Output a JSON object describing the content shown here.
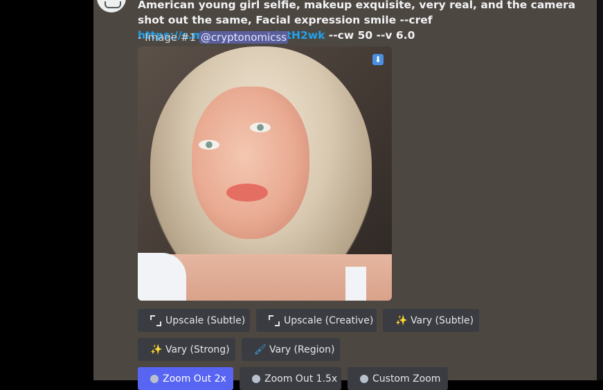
{
  "message": {
    "prompt_text": "American young girl selfie, makeup exquisite, very real, and the camera shot out the same, Facial expression smile --cref ",
    "prompt_link": "https://s.mj.run/WmARjTtH2wk",
    "prompt_suffix": " --cw 50 --v 6.0",
    "image_label": "- Image #1 ",
    "mention": "@cryptonomicss"
  },
  "image": {
    "description_icon": "download-icon",
    "download_glyph": "⬇"
  },
  "buttons": {
    "row1": [
      {
        "label": "Upscale (Subtle)",
        "icon": "expand-icon"
      },
      {
        "label": "Upscale (Creative)",
        "icon": "expand-icon"
      },
      {
        "label": "Vary (Subtle)",
        "icon": "magic-wand-icon"
      }
    ],
    "row2": [
      {
        "label": "Vary (Strong)",
        "icon": "magic-wand-icon"
      },
      {
        "label": "Vary (Region)",
        "icon": "paintbrush-icon"
      }
    ],
    "row3": [
      {
        "label": "Zoom Out 2x",
        "icon": "circle-icon"
      },
      {
        "label": "Zoom Out 1.5x",
        "icon": "circle-icon"
      },
      {
        "label": "Custom Zoom",
        "icon": "circle-icon"
      }
    ]
  },
  "colors": {
    "panel": "#4d4742",
    "link": "#1fa3ec",
    "mention_bg": "#5a5f9c",
    "primary_button": "#5765f2",
    "button": "#3a3c41"
  }
}
